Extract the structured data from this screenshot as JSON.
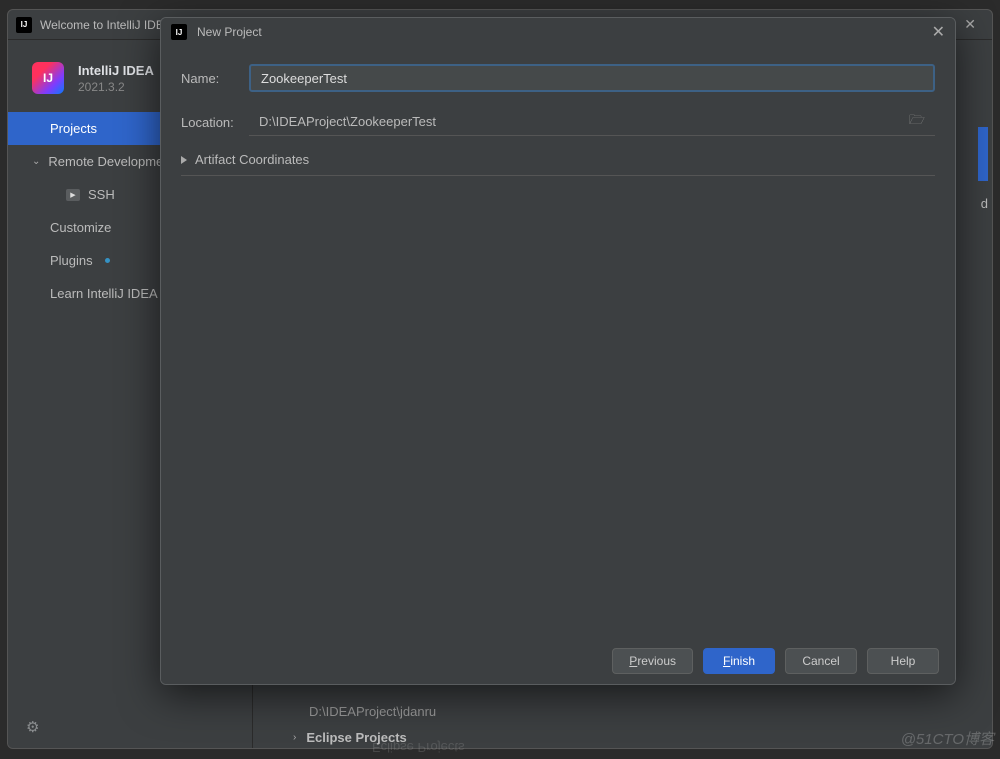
{
  "welcome": {
    "title": "Welcome to IntelliJ IDEA",
    "brand_name": "IntelliJ IDEA",
    "version": "2021.3.2",
    "logo_text": "IJ"
  },
  "sidebar": {
    "items": [
      {
        "label": "Projects",
        "selected": true
      },
      {
        "label": "Remote Development",
        "expandable": true
      },
      {
        "label": "SSH",
        "sub": true
      },
      {
        "label": "Customize"
      },
      {
        "label": "Plugins",
        "has_update": true
      },
      {
        "label": "Learn IntelliJ IDEA"
      }
    ]
  },
  "main_ghost": {
    "path_line": "D:\\IDEAProject\\jdanru",
    "eclipse_row": "Eclipse Projects",
    "reflection": "Eclipse Projects"
  },
  "dialog": {
    "title": "New Project",
    "name_label": "Name:",
    "name_value": "ZookeeperTest",
    "location_label": "Location:",
    "location_value": "D:\\IDEAProject\\ZookeeperTest",
    "artifact_label": "Artifact Coordinates",
    "buttons": {
      "previous": "Previous",
      "finish": "Finish",
      "cancel": "Cancel",
      "help": "Help"
    }
  },
  "watermark": "@51CTO博客"
}
